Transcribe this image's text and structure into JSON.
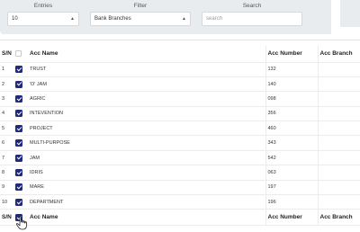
{
  "filters": {
    "entries": {
      "label": "Entries",
      "value": "10"
    },
    "filter": {
      "label": "Filter",
      "value": "Bank Branches"
    },
    "search": {
      "label": "Search",
      "placeholder": "search",
      "value": ""
    }
  },
  "table": {
    "headers": {
      "sn": "S/N",
      "name": "Acc Name",
      "number": "Acc Number",
      "branch": "Acc Branch"
    },
    "rows": [
      {
        "sn": "1",
        "name": "TRUST",
        "number": "132",
        "branch": "",
        "checked": true
      },
      {
        "sn": "2",
        "name": "'O' JAM",
        "number": "140",
        "branch": "",
        "checked": true
      },
      {
        "sn": "3",
        "name": "AGRIC",
        "number": "098",
        "branch": "",
        "checked": true
      },
      {
        "sn": "4",
        "name": "INTEVENTION",
        "number": "356",
        "branch": "",
        "checked": true
      },
      {
        "sn": "5",
        "name": "PROJECT",
        "number": "460",
        "branch": "",
        "checked": true
      },
      {
        "sn": "6",
        "name": "MULTI-PURPOSE",
        "number": "343",
        "branch": "",
        "checked": true
      },
      {
        "sn": "7",
        "name": "JAM",
        "number": "542",
        "branch": "",
        "checked": true
      },
      {
        "sn": "8",
        "name": "IDRIS",
        "number": "063",
        "branch": "",
        "checked": true
      },
      {
        "sn": "9",
        "name": "MARE",
        "number": "197",
        "branch": "",
        "checked": true
      },
      {
        "sn": "10",
        "name": "DEPARTMENT",
        "number": "196",
        "branch": "",
        "checked": true
      }
    ],
    "footer": {
      "sn": "S/N",
      "name": "Acc Name",
      "number": "Acc Number",
      "branch": "Acc Branch"
    }
  },
  "colors": {
    "checkbox": "#1f2a7a",
    "panel": "#e9ecef"
  }
}
